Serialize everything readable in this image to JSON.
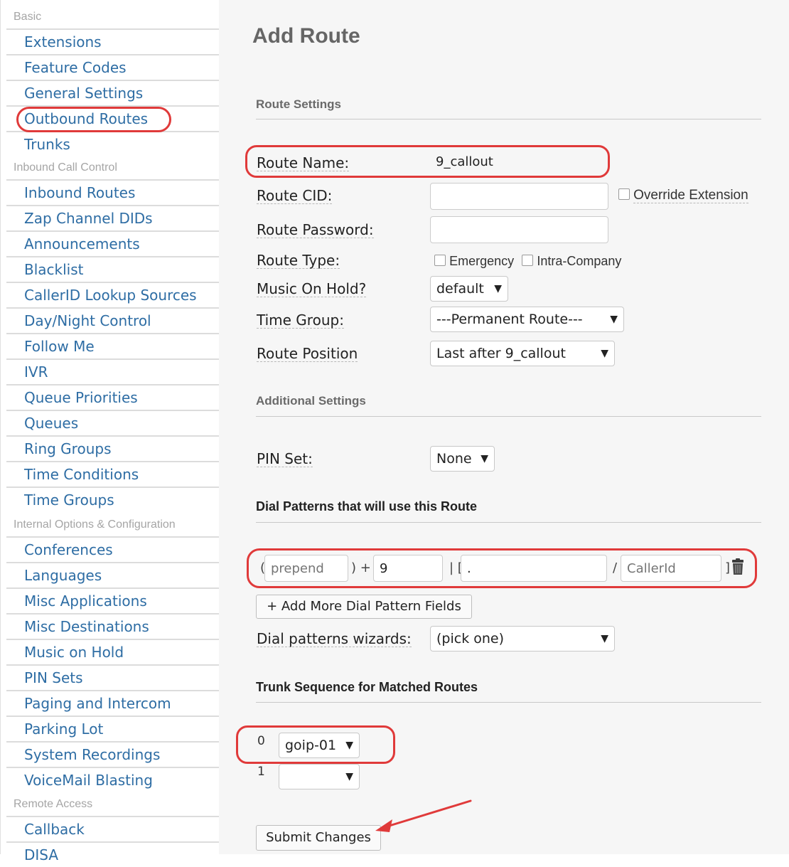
{
  "sidebar": {
    "sections": [
      {
        "header": "Basic",
        "items": [
          "Extensions",
          "Feature Codes",
          "General Settings",
          "Outbound Routes",
          "Trunks"
        ]
      },
      {
        "header": "Inbound Call Control",
        "items": [
          "Inbound Routes",
          "Zap Channel DIDs",
          "Announcements",
          "Blacklist",
          "CallerID Lookup Sources",
          "Day/Night Control",
          "Follow Me",
          "IVR",
          "Queue Priorities",
          "Queues",
          "Ring Groups",
          "Time Conditions",
          "Time Groups"
        ]
      },
      {
        "header": "Internal Options & Configuration",
        "items": [
          "Conferences",
          "Languages",
          "Misc Applications",
          "Misc Destinations",
          "Music on Hold",
          "PIN Sets",
          "Paging and Intercom",
          "Parking Lot",
          "System Recordings",
          "VoiceMail Blasting"
        ]
      },
      {
        "header": "Remote Access",
        "items": [
          "Callback",
          "DISA"
        ]
      }
    ]
  },
  "page": {
    "title": "Add Route",
    "route_settings": {
      "heading": "Route Settings",
      "route_name_label": "Route Name:",
      "route_name_value": "9_callout",
      "route_cid_label": "Route CID:",
      "override_extension_label": "Override Extension",
      "route_password_label": "Route Password:",
      "route_type_label": "Route Type:",
      "emergency_label": "Emergency",
      "intra_company_label": "Intra-Company",
      "music_on_hold_label": "Music On Hold?",
      "music_on_hold_value": "default",
      "time_group_label": "Time Group:",
      "time_group_value": "---Permanent Route---",
      "route_position_label": "Route Position",
      "route_position_value": "Last after 9_callout"
    },
    "additional_settings": {
      "heading": "Additional Settings",
      "pin_set_label": "PIN Set:",
      "pin_set_value": "None"
    },
    "dial_patterns": {
      "heading": "Dial Patterns that will use this Route",
      "open_paren": "(",
      "prepend_value": "prepend",
      "close_paren_plus": ") +",
      "prefix_value": "9",
      "bracket_open": "| [",
      "match_value": ".",
      "slash": "/",
      "callerid_value": "CallerId",
      "bracket_close": "]",
      "add_more_label": "+ Add More Dial Pattern Fields",
      "wizards_label": "Dial patterns wizards:",
      "wizards_value": "(pick one)"
    },
    "trunk_sequence": {
      "heading": "Trunk Sequence for Matched Routes",
      "rows": [
        {
          "index": "0",
          "value": "goip-01"
        },
        {
          "index": "1",
          "value": ""
        }
      ]
    },
    "submit_label": "Submit Changes"
  },
  "colors": {
    "link": "#2e6da4",
    "annotation_red": "#e03a3a",
    "main_background": "#f6f6f6"
  }
}
